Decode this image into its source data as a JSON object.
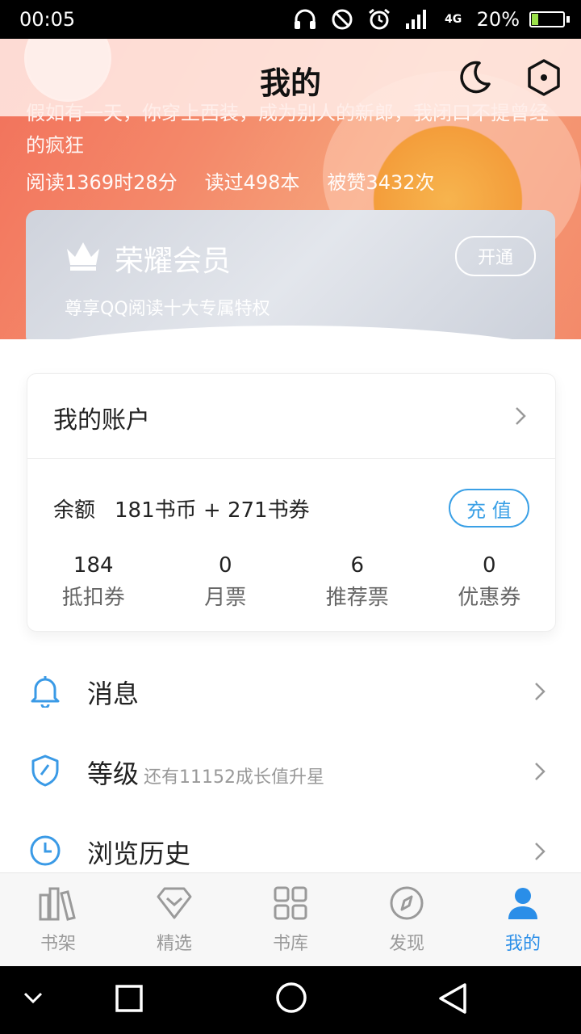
{
  "status_bar": {
    "time": "00:05",
    "battery_percent": "20%",
    "battery_level": 0.2,
    "network": "4G"
  },
  "header": {
    "title": "我的"
  },
  "profile": {
    "signature": "假如有一天，你穿上西装，成为别人的新郎，我闭口不提曾经的疯狂",
    "stats": {
      "read_time": "阅读1369时28分",
      "books_read": "读过498本",
      "likes": "被赞3432次"
    }
  },
  "vip": {
    "title": "荣耀会员",
    "subtitle": "尊享QQ阅读十大专属特权",
    "open_label": "开通"
  },
  "account": {
    "title": "我的账户",
    "balance_label": "余额",
    "balance_value": "181书币 + 271书券",
    "recharge_label": "充 值",
    "counters": [
      {
        "value": "184",
        "label": "抵扣券"
      },
      {
        "value": "0",
        "label": "月票"
      },
      {
        "value": "6",
        "label": "推荐票"
      },
      {
        "value": "0",
        "label": "优惠券"
      }
    ]
  },
  "menu": [
    {
      "label": "消息",
      "sub": "",
      "icon": "bell-icon"
    },
    {
      "label": "等级",
      "sub": "还有11152成长值升星",
      "icon": "shield-icon"
    },
    {
      "label": "浏览历史",
      "sub": "",
      "icon": "clock-icon"
    }
  ],
  "bottom_nav": [
    {
      "label": "书架",
      "icon": "bookshelf-icon"
    },
    {
      "label": "精选",
      "icon": "diamond-icon"
    },
    {
      "label": "书库",
      "icon": "grid-icon"
    },
    {
      "label": "发现",
      "icon": "compass-icon"
    },
    {
      "label": "我的",
      "icon": "user-icon",
      "active": true
    }
  ],
  "colors": {
    "accent": "#2a8ee8",
    "recharge": "#3aa0e6",
    "hero": "#f4896a"
  }
}
